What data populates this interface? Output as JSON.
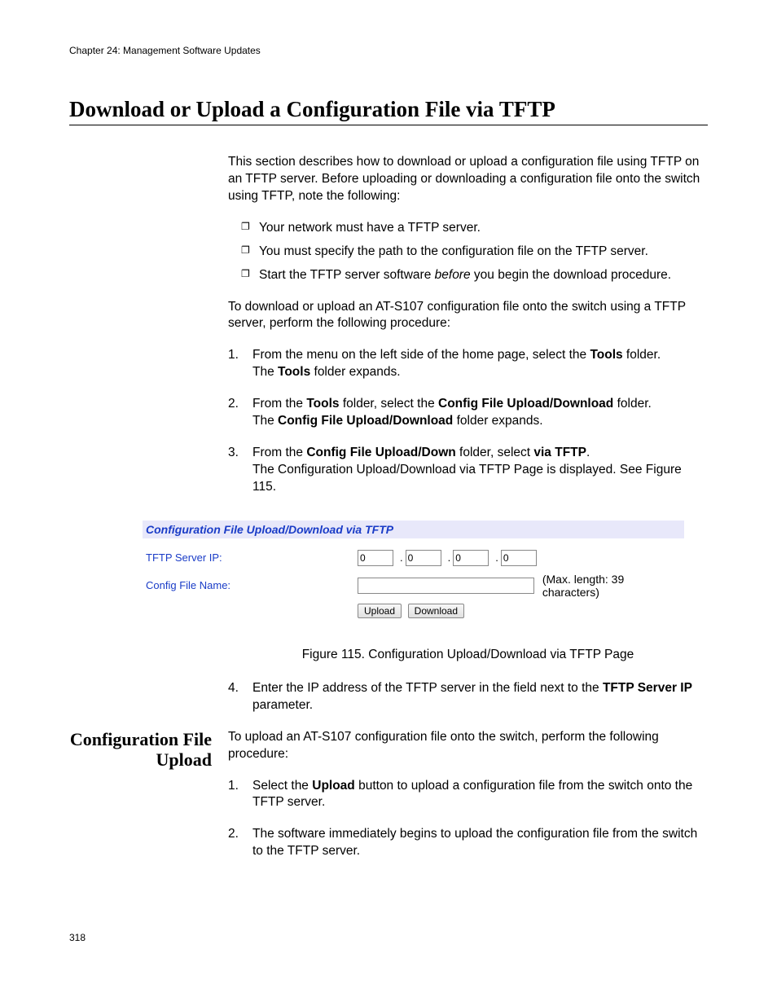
{
  "chapter": "Chapter 24: Management Software Updates",
  "title": "Download or Upload a Configuration File via TFTP",
  "intro": "This section describes how to download or upload a configuration file using TFTP on an TFTP server. Before uploading or downloading a configuration file onto the switch using TFTP, note the following:",
  "bullets": {
    "b1": "Your network must have a TFTP server.",
    "b2": "You must specify the path to the configuration file on the TFTP server.",
    "b3a": "Start the TFTP server software ",
    "b3b": "before",
    "b3c": " you begin the download procedure."
  },
  "lead": "To download or upload an AT-S107 configuration file onto the switch using a TFTP server, perform the following procedure:",
  "steps": {
    "s1a": "From the menu on the left side of the home page, select the ",
    "s1b": "Tools",
    "s1c": " folder.",
    "s1d": "The ",
    "s1e": "Tools",
    "s1f": " folder expands.",
    "s2a": "From the ",
    "s2b": "Tools",
    "s2c": " folder, select the ",
    "s2d": "Config File Upload/Download",
    "s2e": " folder.",
    "s2f": "The ",
    "s2g": "Config File Upload/Download",
    "s2h": " folder expands.",
    "s3a": "From the ",
    "s3b": "Config File Upload/Down",
    "s3c": " folder, select ",
    "s3d": "via TFTP",
    "s3e": ".",
    "s3f": "The Configuration Upload/Download via TFTP Page is displayed. See Figure 115.",
    "s4a": "Enter the IP address of the TFTP server in the field next to the ",
    "s4b": "TFTP Server IP",
    "s4c": " parameter."
  },
  "figure": {
    "header": "Configuration File Upload/Download via TFTP",
    "label_ip": "TFTP Server IP:",
    "label_name": "Config File Name:",
    "ip": {
      "a": "0",
      "b": "0",
      "c": "0",
      "d": "0"
    },
    "hint": "(Max. length: 39 characters)",
    "btn_upload": "Upload",
    "btn_download": "Download",
    "caption": "Figure 115. Configuration Upload/Download via TFTP Page"
  },
  "side": {
    "heading": "Configuration File Upload",
    "intro": "To upload an AT-S107 configuration file onto the switch, perform the following procedure:",
    "s1a": "Select the ",
    "s1b": "Upload",
    "s1c": " button to upload a configuration file from the switch onto the TFTP server.",
    "s2": "The software immediately begins to upload the configuration file from the switch to the TFTP server."
  },
  "page_number": "318"
}
